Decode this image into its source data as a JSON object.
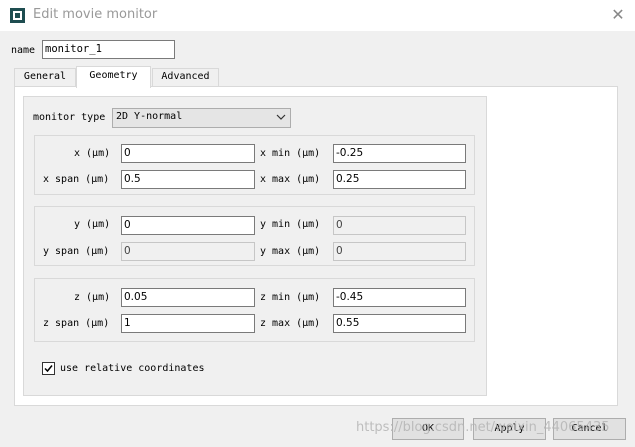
{
  "window": {
    "title": "Edit movie monitor",
    "close_icon": "close-icon"
  },
  "name_field": {
    "label": "name",
    "value": "monitor_1"
  },
  "tabs": [
    {
      "label": "General"
    },
    {
      "label": "Geometry"
    },
    {
      "label": "Advanced"
    }
  ],
  "monitor_type": {
    "label": "monitor type",
    "value": "2D Y-normal"
  },
  "x_group": {
    "x_label": "x (μm)",
    "x_value": "0",
    "span_label": "x span (μm)",
    "span_value": "0.5",
    "min_label": "x min (μm)",
    "min_value": "-0.25",
    "max_label": "x max (μm)",
    "max_value": "0.25"
  },
  "y_group": {
    "y_label": "y (μm)",
    "y_value": "0",
    "span_label": "y span (μm)",
    "span_value": "0",
    "min_label": "y min (μm)",
    "min_value": "0",
    "max_label": "y max (μm)",
    "max_value": "0"
  },
  "z_group": {
    "z_label": "z (μm)",
    "z_value": "0.05",
    "span_label": "z span (μm)",
    "span_value": "1",
    "min_label": "z min (μm)",
    "min_value": "-0.45",
    "max_label": "z max (μm)",
    "max_value": "0.55"
  },
  "relative_coords": {
    "label": "use relative coordinates",
    "checked": true
  },
  "buttons": {
    "ok": "OK",
    "apply": "Apply",
    "cancel": "Cancel"
  },
  "watermark": "https://blog.csdn.net/weixin_44065435"
}
